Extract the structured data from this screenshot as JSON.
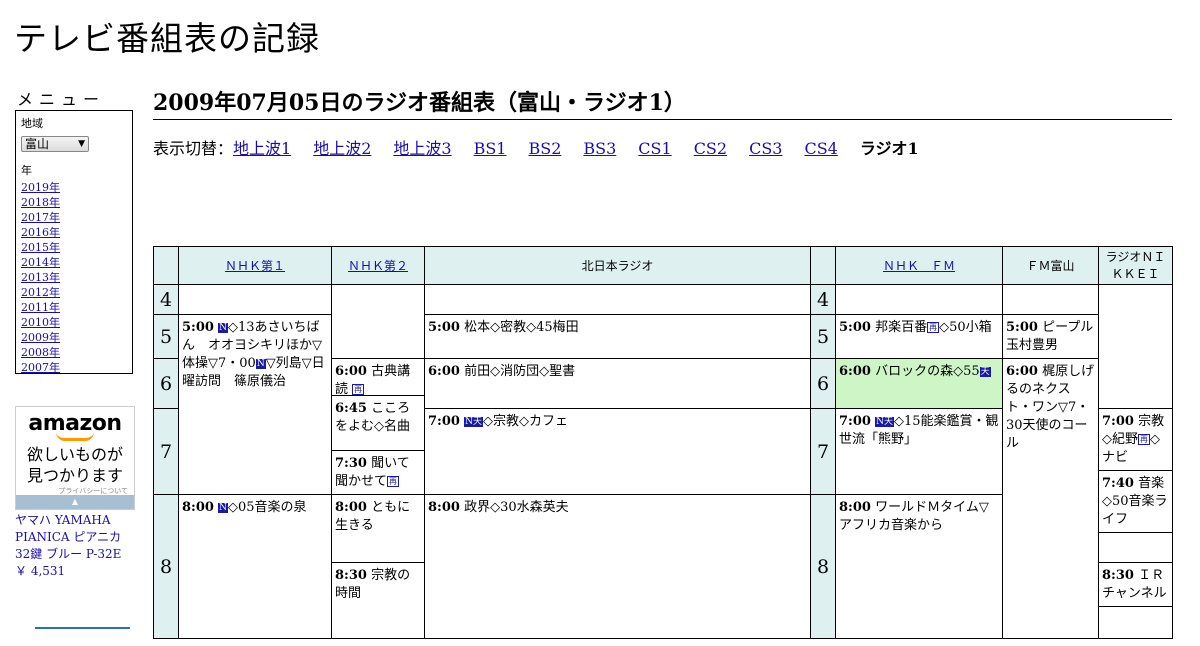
{
  "site_title": "テレビ番組表の記録",
  "menu": {
    "title": "メニュー",
    "region_label": "地域",
    "region_value": "富山",
    "year_label": "年",
    "years": [
      "2019年",
      "2018年",
      "2017年",
      "2016年",
      "2015年",
      "2014年",
      "2013年",
      "2012年",
      "2011年",
      "2010年",
      "2009年",
      "2008年",
      "2007年"
    ]
  },
  "ad": {
    "brand": "amazon",
    "copy_line1": "欲しいものが",
    "copy_line2": "見つかります",
    "privacy": "プライバシーについて",
    "product_name": "ヤマハ YAMAHA PIANICA ピアニカ 32鍵 ブルー P-32E",
    "product_price": "￥ 4,531"
  },
  "page_heading": "2009年07月05日のラジオ番組表（富山・ラジオ1）",
  "switcher": {
    "label": "表示切替：",
    "links": [
      "地上波1",
      "地上波2",
      "地上波3",
      "BS1",
      "BS2",
      "BS3",
      "CS1",
      "CS2",
      "CS3",
      "CS4"
    ],
    "current": "ラジオ1"
  },
  "channels": [
    "ＮＨＫ第１",
    "ＮＨＫ第２",
    "北日本ラジオ",
    "ＮＨＫ　ＦＭ",
    "ＦＭ富山",
    "ラジオＮＩＫＫＥＩ"
  ],
  "hours": [
    "4",
    "5",
    "6",
    "7",
    "8"
  ],
  "programs": {
    "nhk1_0500_time": "5:00",
    "nhk1_0500_title": "◇13あさいちばん　オオヨシキリほか▽体操▽7・00",
    "nhk1_0500_title2": "▽列島▽日曜訪問　篠原儀治",
    "nhk1_0800_time": "8:00",
    "nhk1_0800_title": "◇05音楽の泉",
    "nhk2_0600_time": "6:00",
    "nhk2_0600_title": "古典講読",
    "nhk2_0645_time": "6:45",
    "nhk2_0645_title": "こころをよむ◇名曲",
    "nhk2_0730_time": "7:30",
    "nhk2_0730_title": "聞いて聞かせて",
    "nhk2_0800_time": "8:00",
    "nhk2_0800_title": "ともに生きる",
    "nhk2_0830_time": "8:30",
    "nhk2_0830_title": "宗教の時間",
    "knb_0500_time": "5:00",
    "knb_0500_title": "松本◇密教◇45梅田",
    "knb_0600_time": "6:00",
    "knb_0600_title": "前田◇消防団◇聖書",
    "knb_0700_time": "7:00",
    "knb_0700_title": "◇宗教◇カフェ",
    "knb_0800_time": "8:00",
    "knb_0800_title": "政界◇30水森英夫",
    "nhkfm_0500_time": "5:00",
    "nhkfm_0500_title": "邦楽百番",
    "nhkfm_0500_title2": "◇50小箱",
    "nhkfm_0600_time": "6:00",
    "nhkfm_0600_title": "バロックの森◇55",
    "nhkfm_0700_time": "7:00",
    "nhkfm_0700_title": "◇15能楽鑑賞・観世流「熊野」",
    "nhkfm_0800_time": "8:00",
    "nhkfm_0800_title": "ワールドＭタイム▽アフリカ音楽から",
    "fmt_0500_time": "5:00",
    "fmt_0500_title": "ピープル　玉村豊男",
    "fmt_0600_time": "6:00",
    "fmt_0600_title": "梶原しげるのネクスト・ワン▽7・30天使のコール",
    "nikkei_0700_time": "7:00",
    "nikkei_0700_title": "宗教◇紀野",
    "nikkei_0700_title2": "◇ナビ",
    "nikkei_0740_time": "7:40",
    "nikkei_0740_title": "音楽◇50音楽ライフ",
    "nikkei_0830_time": "8:30",
    "nikkei_0830_title": "ＩＲチャンネル"
  },
  "badges": {
    "n": "N",
    "nten": "N天",
    "ten": "天",
    "sai": "再"
  }
}
